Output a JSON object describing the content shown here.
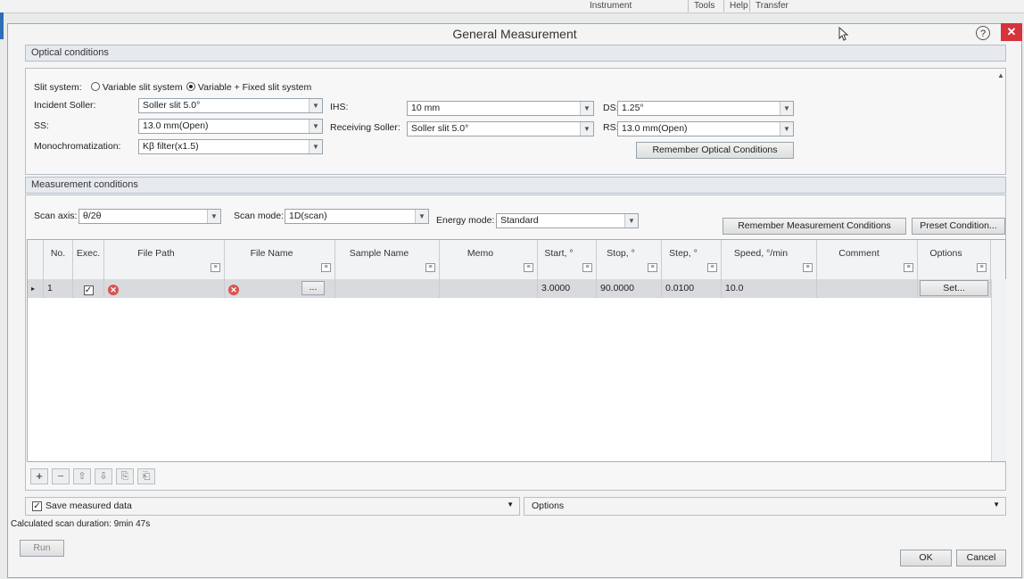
{
  "app_menu": {
    "instrument": "Instrument",
    "tools": "Tools",
    "help": "Help",
    "transfer": "Transfer"
  },
  "window": {
    "title": "General Measurement",
    "help_glyph": "?",
    "close_glyph": "✕"
  },
  "optical": {
    "section_title": "Optical conditions",
    "slit_system_label": "Slit system:",
    "slit_options": [
      "Variable slit system",
      "Variable + Fixed slit system"
    ],
    "slit_selected": "Variable + Fixed slit system",
    "incident_soller_label": "Incident Soller:",
    "incident_soller_value": "Soller slit 5.0°",
    "ss_label": "SS:",
    "ss_value": "13.0 mm(Open)",
    "mono_label": "Monochromatization:",
    "mono_value": "Kβ filter(x1.5)",
    "ihs_label": "IHS:",
    "ihs_value": "10 mm",
    "receiving_soller_label": "Receiving Soller:",
    "receiving_soller_value": "Soller slit 5.0°",
    "ds_label": "DS:",
    "ds_value": "1.25°",
    "rs_label": "RS:",
    "rs_value": "13.0 mm(Open)",
    "remember_button": "Remember Optical Conditions"
  },
  "measurement": {
    "section_title": "Measurement conditions",
    "scan_axis_label": "Scan axis:",
    "scan_axis_value": "θ/2θ",
    "scan_mode_label": "Scan mode:",
    "scan_mode_value": "1D(scan)",
    "energy_mode_label": "Energy mode:",
    "energy_mode_value": "Standard",
    "remember_button": "Remember Measurement Conditions",
    "preset_button": "Preset Condition..."
  },
  "table": {
    "columns": [
      "No.",
      "Exec.",
      "File Path",
      "File Name",
      "Sample Name",
      "Memo",
      "Start, °",
      "Stop, °",
      "Step, °",
      "Speed, °/min",
      "Comment",
      "Options"
    ],
    "rows": [
      {
        "no": "1",
        "exec": "✓",
        "file_path": "",
        "file_name": "",
        "sample_name": "",
        "memo": "",
        "start": "3.0000",
        "stop": "90.0000",
        "step": "0.0100",
        "speed": "10.0",
        "comment": "",
        "options": "Set..."
      }
    ],
    "filter_glyph": "≡",
    "name_button": "...",
    "row_marker": "▸"
  },
  "toolbar": {
    "add": "+",
    "remove": "−",
    "up": "⇧",
    "down": "⇩",
    "copy": "⎘",
    "paste": "⎗"
  },
  "bottom": {
    "save_label": "Save measured data",
    "options_label": "Options",
    "duration_label": "Calculated scan duration: 9min 47s",
    "run_button": "Run",
    "ok_button": "OK",
    "cancel_button": "Cancel"
  },
  "colors": {
    "close": "#d6333c",
    "error": "#d9534f",
    "selected_row": "#d8dadd"
  },
  "icons": {
    "help": "help-icon",
    "close": "close-icon",
    "error": "error-icon",
    "cursor": "cursor-icon",
    "dropdown": "chevron-down-icon"
  }
}
